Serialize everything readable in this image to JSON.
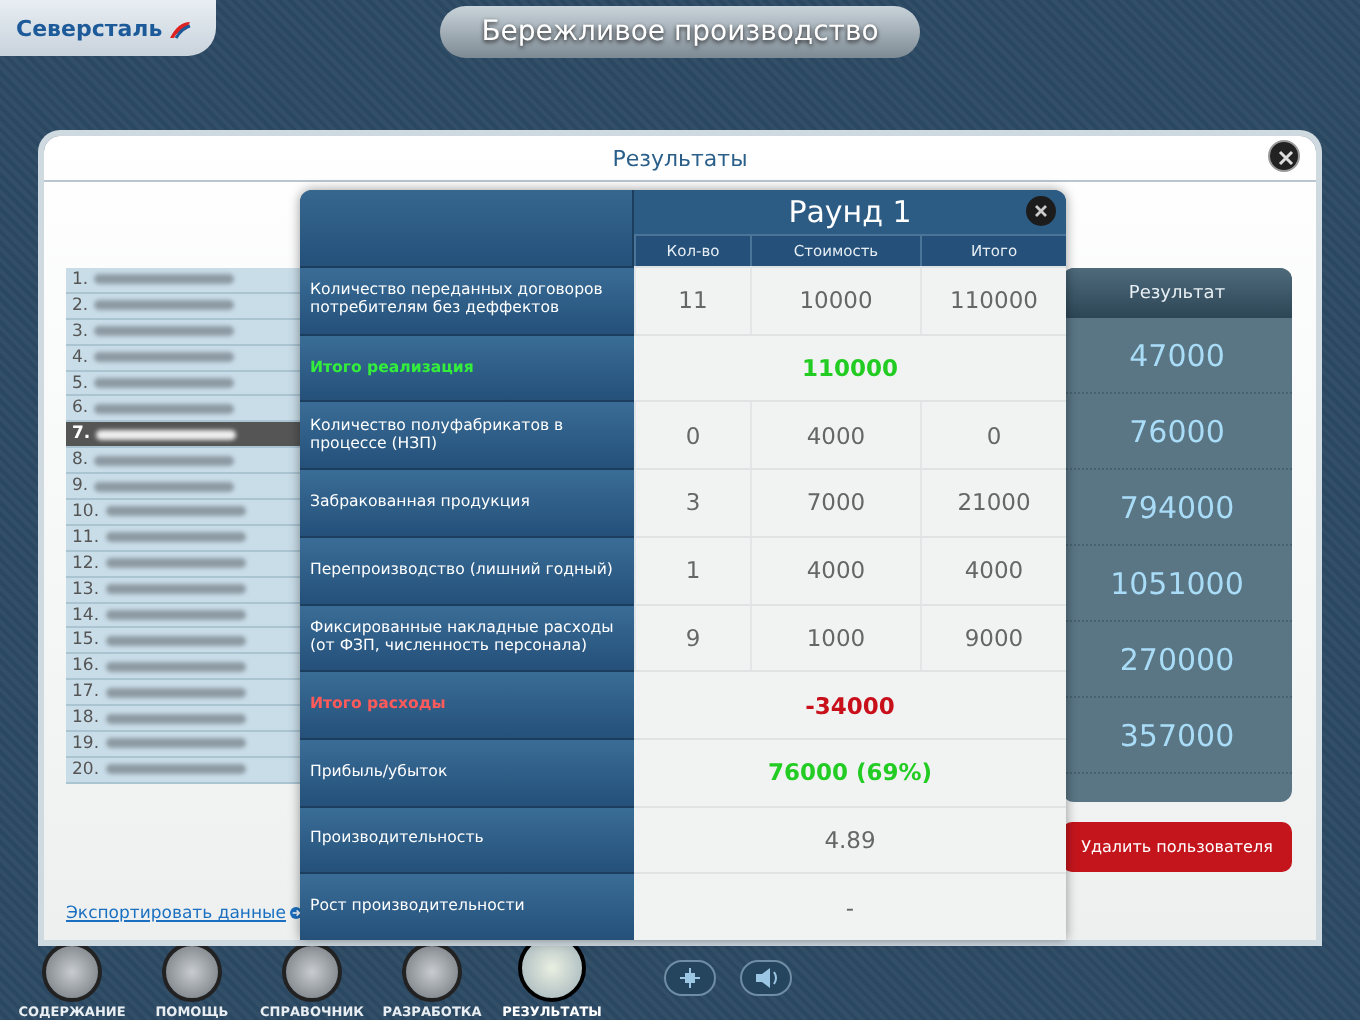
{
  "app": {
    "logo": "Северсталь",
    "title": "Бережливое производство"
  },
  "window": {
    "title": "Результаты"
  },
  "players": [
    {
      "number": "1.",
      "selected": false
    },
    {
      "number": "2.",
      "selected": false
    },
    {
      "number": "3.",
      "selected": false
    },
    {
      "number": "4.",
      "selected": false
    },
    {
      "number": "5.",
      "selected": false
    },
    {
      "number": "6.",
      "selected": false
    },
    {
      "number": "7.",
      "selected": true
    },
    {
      "number": "8.",
      "selected": false
    },
    {
      "number": "9.",
      "selected": false
    },
    {
      "number": "10.",
      "selected": false
    },
    {
      "number": "11.",
      "selected": false
    },
    {
      "number": "12.",
      "selected": false
    },
    {
      "number": "13.",
      "selected": false
    },
    {
      "number": "14.",
      "selected": false
    },
    {
      "number": "15.",
      "selected": false
    },
    {
      "number": "16.",
      "selected": false
    },
    {
      "number": "17.",
      "selected": false
    },
    {
      "number": "18.",
      "selected": false
    },
    {
      "number": "19.",
      "selected": false
    },
    {
      "number": "20.",
      "selected": false
    }
  ],
  "export_link": "Экспортировать данные",
  "results": {
    "header": "Результат",
    "values": [
      "47000",
      "76000",
      "794000",
      "1051000",
      "270000",
      "357000"
    ]
  },
  "delete_button": "Удалить пользователя",
  "round": {
    "title": "Раунд 1",
    "columns": [
      "Кол-во",
      "Стоимость",
      "Итого"
    ],
    "rows": [
      {
        "kind": "detail",
        "label": "Количество переданных договоров потребителям без деффектов",
        "quantity": "11",
        "price": "10000",
        "total": "110000"
      },
      {
        "kind": "income",
        "label": "Итого реализация",
        "value": "110000"
      },
      {
        "kind": "detail",
        "label": "Количество полуфабрикатов в процессе (НЗП)",
        "quantity": "0",
        "price": "4000",
        "total": "0"
      },
      {
        "kind": "detail",
        "label": "Забракованная продукция",
        "quantity": "3",
        "price": "7000",
        "total": "21000"
      },
      {
        "kind": "detail",
        "label": "Перепроизводство (лишний годный)",
        "quantity": "1",
        "price": "4000",
        "total": "4000"
      },
      {
        "kind": "detail",
        "label": "Фиксированные накладные расходы (от ФЗП, численность персонала)",
        "quantity": "9",
        "price": "1000",
        "total": "9000"
      },
      {
        "kind": "expense",
        "label": "Итого расходы",
        "value": "-34000"
      },
      {
        "kind": "profit",
        "label": "Прибыль/убыток",
        "value": "76000 (69%)"
      },
      {
        "kind": "metric",
        "label": "Производительность",
        "value": "4.89"
      },
      {
        "kind": "metric",
        "label": "Рост производительности",
        "value": "-"
      }
    ]
  },
  "nav": [
    {
      "label": "СОДЕРЖАНИЕ",
      "selected": false
    },
    {
      "label": "ПОМОЩЬ",
      "selected": false
    },
    {
      "label": "СПРАВОЧНИК",
      "selected": false
    },
    {
      "label": "РАЗРАБОТКА",
      "selected": false
    },
    {
      "label": "РЕЗУЛЬТАТЫ",
      "selected": true
    }
  ]
}
